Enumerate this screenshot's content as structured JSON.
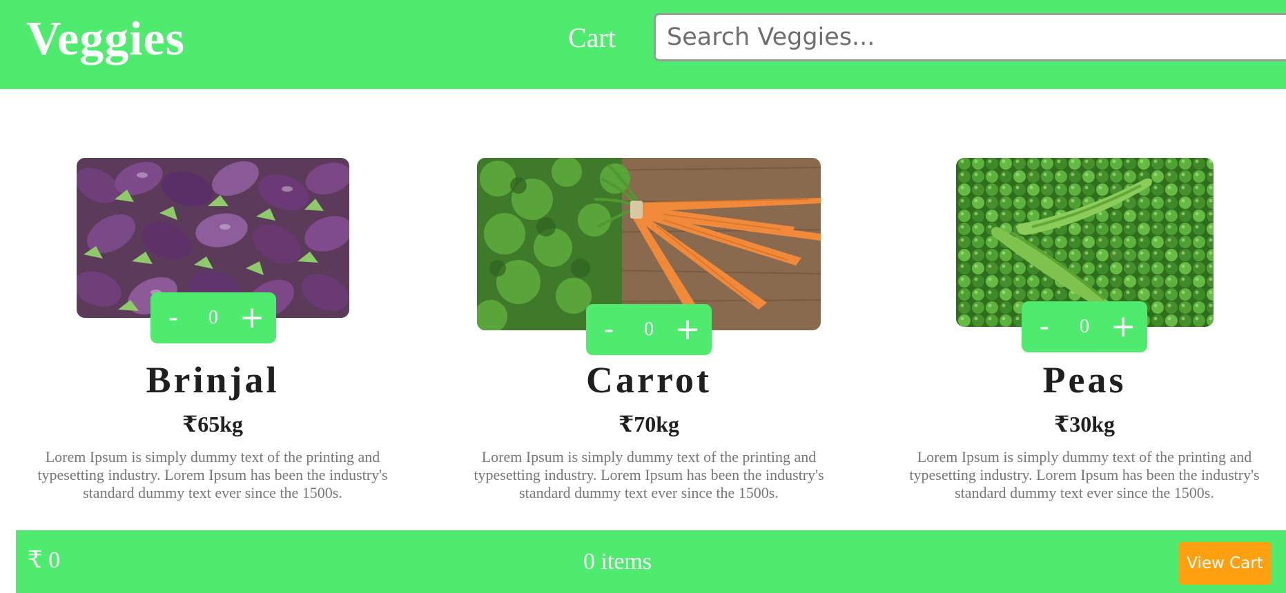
{
  "header": {
    "brand": "Veggies",
    "cart_link": "Cart",
    "search_placeholder": "Search Veggies...",
    "search_value": ""
  },
  "products": [
    {
      "name": "Brinjal",
      "price": "₹65kg",
      "quantity": "0",
      "minus_label": "-",
      "plus_label": "+",
      "description": "Lorem Ipsum is simply dummy text of the printing and typesetting industry. Lorem Ipsum has been the industry's standard dummy text ever since the 1500s.",
      "image": "brinjal-photo"
    },
    {
      "name": "Carrot",
      "price": "₹70kg",
      "quantity": "0",
      "minus_label": "-",
      "plus_label": "+",
      "description": "Lorem Ipsum is simply dummy text of the printing and typesetting industry. Lorem Ipsum has been the industry's standard dummy text ever since the 1500s.",
      "image": "carrot-photo"
    },
    {
      "name": "Peas",
      "price": "₹30kg",
      "quantity": "0",
      "minus_label": "-",
      "plus_label": "+",
      "description": "Lorem Ipsum is simply dummy text of the printing and typesetting industry. Lorem Ipsum has been the industry's standard dummy text ever since the 1500s.",
      "image": "peas-photo"
    }
  ],
  "footer": {
    "total": "₹ 0",
    "items_count": "0 items",
    "view_cart_label": "View Cart"
  },
  "colors": {
    "accent_green": "#4eeb6e",
    "view_cart_orange": "#ffa010",
    "text_dark": "#1f1f1f",
    "text_muted": "#777777"
  }
}
